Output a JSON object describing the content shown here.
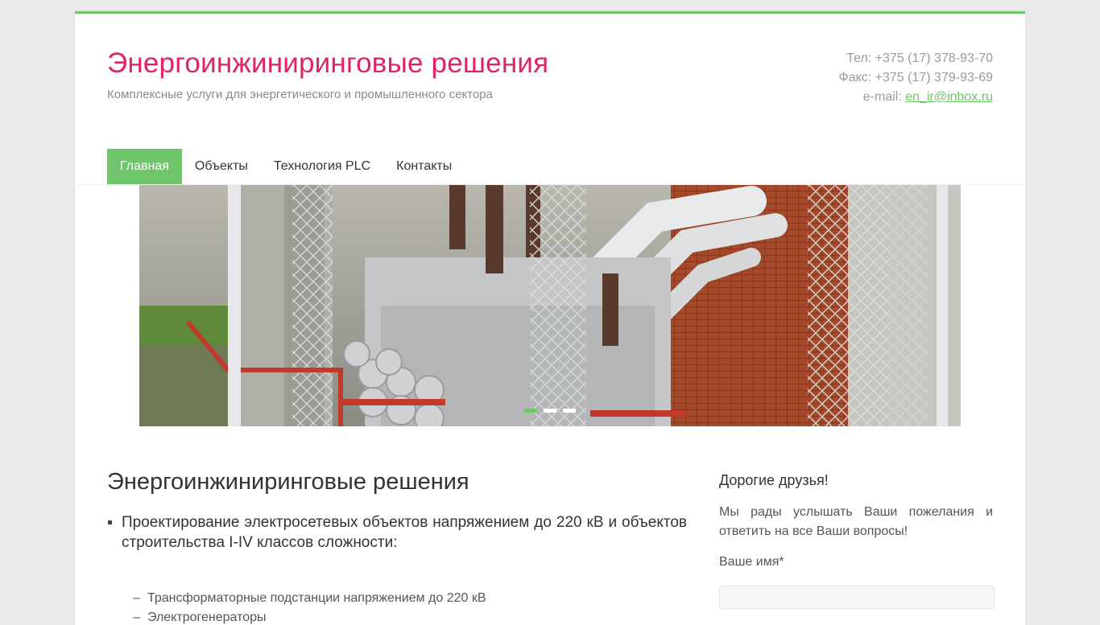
{
  "header": {
    "title": "Энергоинжиниринговые решения",
    "tagline": "Комплексные услуги для энергетического и промышленного сектора",
    "phone": "Тел: +375 (17) 378-93-70",
    "fax": "Факс: +375 (17) 379-93-69",
    "email_label": "e-mail: ",
    "email": "en_ir@inbox.ru"
  },
  "nav": {
    "items": [
      "Главная",
      "Объекты",
      "Технология PLC",
      "Контакты"
    ]
  },
  "slider": {
    "current_index": 1,
    "slide_count": 3
  },
  "main": {
    "title": "Энергоинжиниринговые решения",
    "bullet": "Проектирование электросетевых объектов напряжением до 220 кВ и объектов строительства I-IV классов сложности:",
    "sub_items": [
      "Трансформаторные подстанции напряжением до 220 кВ",
      "Электрогенераторы"
    ]
  },
  "sidebar": {
    "title": "Дорогие друзья!",
    "text": "Мы рады услышать Ваши пожелания и ответить на все Ваши вопросы!",
    "name_label": "Ваше имя*",
    "name_value": ""
  },
  "colors": {
    "accent": "#6fc56a",
    "title": "#e0245e"
  }
}
